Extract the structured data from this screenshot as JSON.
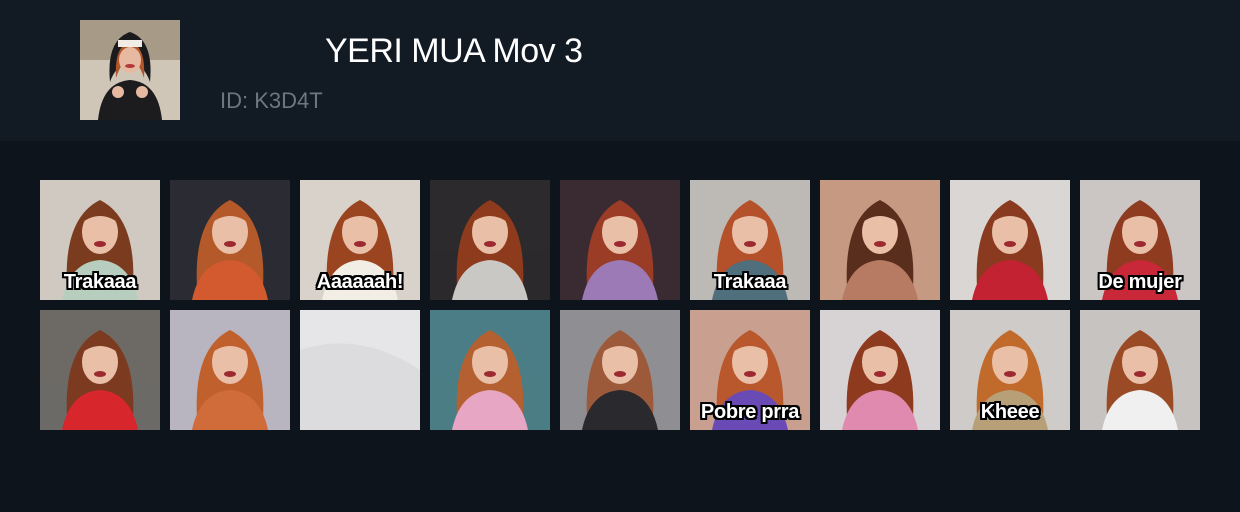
{
  "profile": {
    "title": "YERI MUA Mov 3",
    "id_text": "ID: K3D4T",
    "avatar_icon": "profile-photo"
  },
  "grid": {
    "tiles": [
      {
        "caption": "Trakaaa",
        "bg": "#cfc9c2",
        "accent": "#b7cdbd",
        "hair": "#7a3b1f"
      },
      {
        "caption": "",
        "bg": "#2b2b33",
        "accent": "#d25a2e",
        "hair": "#b45a2a"
      },
      {
        "caption": "Aaaaaah!",
        "bg": "#d8d2cb",
        "accent": "#f2eee6",
        "hair": "#9a4520"
      },
      {
        "caption": "",
        "bg": "#2c2a2c",
        "accent": "#c9c8c4",
        "hair": "#8e3a1c"
      },
      {
        "caption": "",
        "bg": "#3a2b33",
        "accent": "#9b7ab6",
        "hair": "#9a3c26"
      },
      {
        "caption": "Trakaaa",
        "bg": "#bdb9b4",
        "accent": "#4f6f7c",
        "hair": "#b4502a"
      },
      {
        "caption": "",
        "bg": "#c69a82",
        "accent": "#b77a62",
        "hair": "#5a2e1c"
      },
      {
        "caption": "",
        "bg": "#d9d6d3",
        "accent": "#c32233",
        "hair": "#8a3a1e"
      },
      {
        "caption": "De mujer",
        "bg": "#cbc6c4",
        "accent": "#c82838",
        "hair": "#8e3b20"
      },
      {
        "caption": "",
        "bg": "#6d6a66",
        "accent": "#d8262d",
        "hair": "#7c3a20"
      },
      {
        "caption": "",
        "bg": "#b8b4c0",
        "accent": "#d06b3a",
        "hair": "#c0602c"
      },
      {
        "caption": "",
        "bg": "#e6e6e8",
        "accent": "#f2f2f4",
        "hair": "#e6e6e8"
      },
      {
        "caption": "",
        "bg": "#4b7d86",
        "accent": "#e7a6c4",
        "hair": "#b46030"
      },
      {
        "caption": "",
        "bg": "#8f8f93",
        "accent": "#2a2a2e",
        "hair": "#9c5a3a"
      },
      {
        "caption": "Pobre prra",
        "bg": "#c9a090",
        "accent": "#6a4bb6",
        "hair": "#b8582c"
      },
      {
        "caption": "",
        "bg": "#d7d3d4",
        "accent": "#e08ab0",
        "hair": "#8e3a1e"
      },
      {
        "caption": "Kheee",
        "bg": "#cfcbc8",
        "accent": "#b7a078",
        "hair": "#c06a2c"
      },
      {
        "caption": "",
        "bg": "#c7c3c0",
        "accent": "#f0f0f0",
        "hair": "#9a4a24"
      }
    ]
  }
}
